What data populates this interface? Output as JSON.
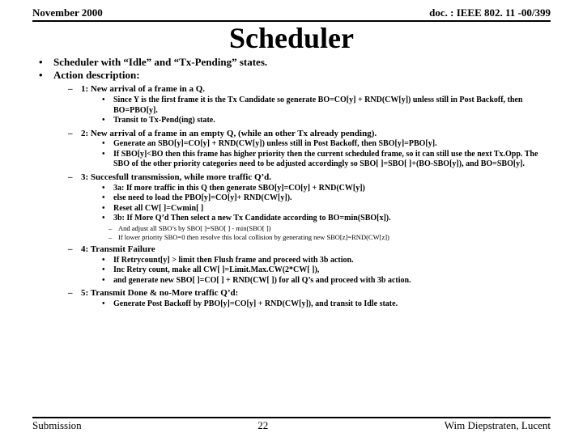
{
  "header": {
    "left": "November 2000",
    "right": "doc. : IEEE 802. 11 -00/399"
  },
  "title": "Scheduler",
  "bullets": [
    "Scheduler with “Idle” and “Tx-Pending” states.",
    "Action description:"
  ],
  "sections": [
    {
      "h": "1: New arrival of a frame in a Q.",
      "items": [
        "Since Y is the first frame it is the Tx Candidate so generate BO=CO[y] + RND(CW[y]) unless still in Post Backoff, then BO=PBO[y].",
        "Transit to Tx-Pend(ing) state."
      ]
    },
    {
      "h": "2: New arrival of a frame in an empty Q, (while an other Tx already pending).",
      "items": [
        "Generate an SBO[y]=CO[y] + RND(CW[y]) unless still in Post Backoff, then SBO[y]=PBO[y].",
        "If SBO[y]<BO then this frame has higher priority then the current scheduled frame, so it can still use the next Tx.Opp. The SBO of the other priority categories need to be adjusted accordingly so SBO[ ]=SBO[ ]+(BO-SBO[y]), and BO=SBO[y]."
      ]
    },
    {
      "h": "3: Succesfull transmission, while more traffic Q’d.",
      "items": [
        "3a: If more traffic in this Q then generate SBO[y]=CO[y] + RND(CW[y])",
        "else need to load the PBO[y]=CO[y]+ RND(CW[y]).",
        "Reset all CW[ ]=Cwmin[ ]",
        "3b: If More Q’d Then select a new Tx Candidate according to BO=min(SBO[x])."
      ],
      "sub": [
        "And adjust all SBO’s by SBO[ ]=SBO[ ] - min(SBO[ ])",
        "If lower priority SBO=0 then resolve this local collision by generating new SBO[z]=RND(CW[z])"
      ]
    },
    {
      "h": "4: Transmit Failure",
      "items": [
        "If Retrycount[y] > limit then Flush frame and proceed with 3b action.",
        "Inc Retry count, make all CW[ ]=Limit.Max.CW(2*CW[ ]),",
        "and generate new SBO[ ]=CO[ ] + RND(CW[ ]) for all Q’s and proceed with 3b action."
      ]
    },
    {
      "h": "5: Transmit Done & no-More traffic Q’d:",
      "items": [
        "Generate Post Backoff by PBO[y]=CO[y] + RND(CW[y]), and transit to Idle state."
      ]
    }
  ],
  "footer": {
    "left": "Submission",
    "center": "22",
    "right": "Wim Diepstraten, Lucent"
  }
}
